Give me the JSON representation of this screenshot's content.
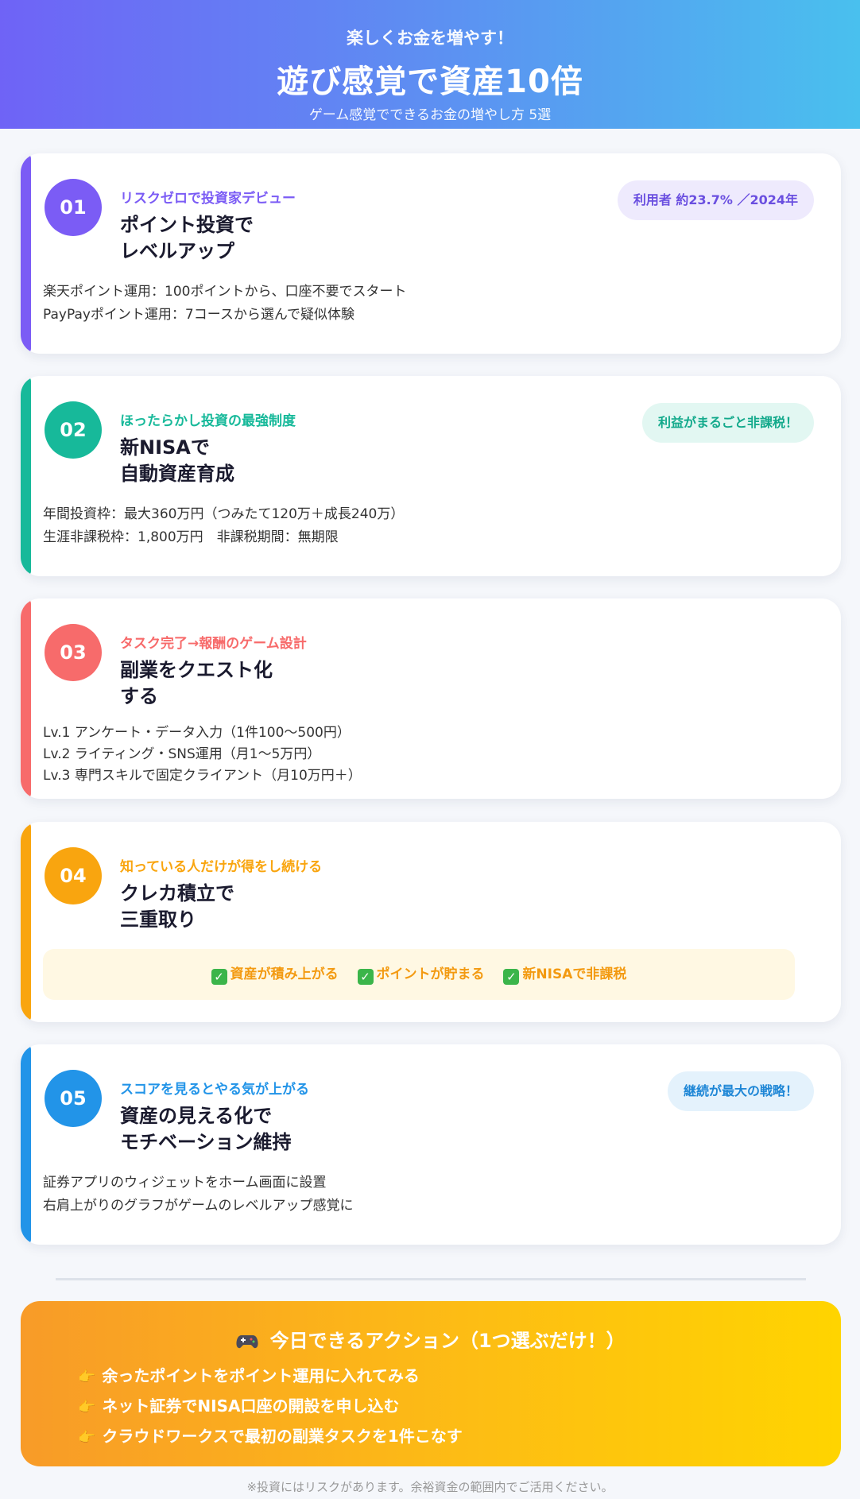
{
  "header": {
    "subtitle": "楽しくお金を増やす！",
    "title": "遊び感覚で資産10倍",
    "tagline": "ゲーム感覚でできるお金の増やし方 5選"
  },
  "cards": [
    {
      "number": "01",
      "kicker": "リスクゼロで投資家デビュー",
      "title_line1": "ポイント投資で",
      "title_line2": "レベルアップ",
      "badge": "利用者 約23.7% ／2024年",
      "details": [
        "楽天ポイント運用：100ポイントから、口座不要でスタート",
        "PayPayポイント運用：7コースから選んで疑似体験"
      ],
      "accent": "#7b5cf5",
      "badge_bg": "#eeeafd",
      "badge_color": "#6a4fe0"
    },
    {
      "number": "02",
      "kicker": "ほったらかし投資の最強制度",
      "title_line1": "新NISAで",
      "title_line2": "自動資産育成",
      "badge": "利益がまるごと非課税！",
      "details": [
        "年間投資枠：最大360万円（つみたて120万＋成長240万）",
        "生涯非課税枠：1,800万円　非課税期間：無期限"
      ],
      "accent": "#17b99a",
      "badge_bg": "#e2f7f2",
      "badge_color": "#12a98b"
    },
    {
      "number": "03",
      "kicker": "タスク完了→報酬のゲーム設計",
      "title_line1": "副業をクエスト化",
      "title_line2": "する",
      "details": [
        "Lv.1 アンケート・データ入力（1件100〜500円）",
        "Lv.2 ライティング・SNS運用（月1〜5万円）",
        "Lv.3 専門スキルで固定クライアント（月10万円＋）"
      ],
      "accent": "#f76b6b"
    },
    {
      "number": "04",
      "kicker": "知っている人だけが得をし続ける",
      "title_line1": "クレカ積立で",
      "title_line2": "三重取り",
      "perks": [
        "資産が積み上がる",
        "ポイントが貯まる",
        "新NISAで非課税"
      ],
      "accent": "#f9a50f"
    },
    {
      "number": "05",
      "kicker": "スコアを見るとやる気が上がる",
      "title_line1": "資産の見える化で",
      "title_line2": "モチベーション維持",
      "badge": "継続が最大の戦略！",
      "details": [
        "証券アプリのウィジェットをホーム画面に設置",
        "右肩上がりのグラフがゲームのレベルアップ感覚に"
      ],
      "accent": "#2294e8",
      "badge_bg": "#e4f2fc",
      "badge_color": "#1f87d6"
    }
  ],
  "action": {
    "title": "今日できるアクション（1つ選ぶだけ！）",
    "items": [
      "余ったポイントをポイント運用に入れてみる",
      "ネット証券でNISA口座の開設を申し込む",
      "クラウドワークスで最初の副業タスクを1件こなす"
    ]
  },
  "footnote": "※投資にはリスクがあります。余裕資金の範囲内でご活用ください。",
  "icons": {
    "check": "check-icon",
    "controller": "game-controller-icon",
    "pointing": "pointing-hand-icon"
  }
}
